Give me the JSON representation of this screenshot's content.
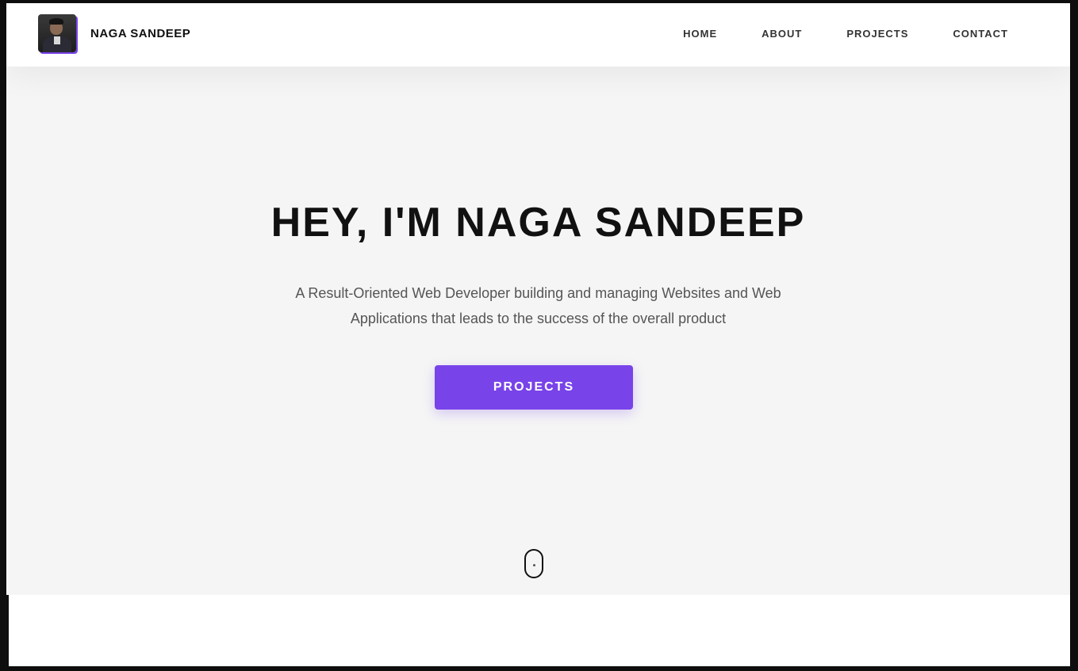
{
  "header": {
    "brand_name": "NAGA SANDEEP",
    "avatar_alt": "Naga Sandeep profile photo",
    "nav": [
      {
        "label": "HOME"
      },
      {
        "label": "ABOUT"
      },
      {
        "label": "PROJECTS"
      },
      {
        "label": "CONTACT"
      }
    ]
  },
  "hero": {
    "title": "HEY, I'M NAGA SANDEEP",
    "subtitle_line1": "A Result-Oriented Web Developer building and managing Websites and Web",
    "subtitle_line2": "Applications that leads to the success of the overall product",
    "cta_label": "PROJECTS"
  },
  "colors": {
    "accent": "#7843e9",
    "hero_bg": "#f5f5f5",
    "header_bg": "#ffffff",
    "text_dark": "#111111",
    "text_muted": "#555555"
  },
  "icons": {
    "scroll": "mouse-scroll-icon"
  }
}
